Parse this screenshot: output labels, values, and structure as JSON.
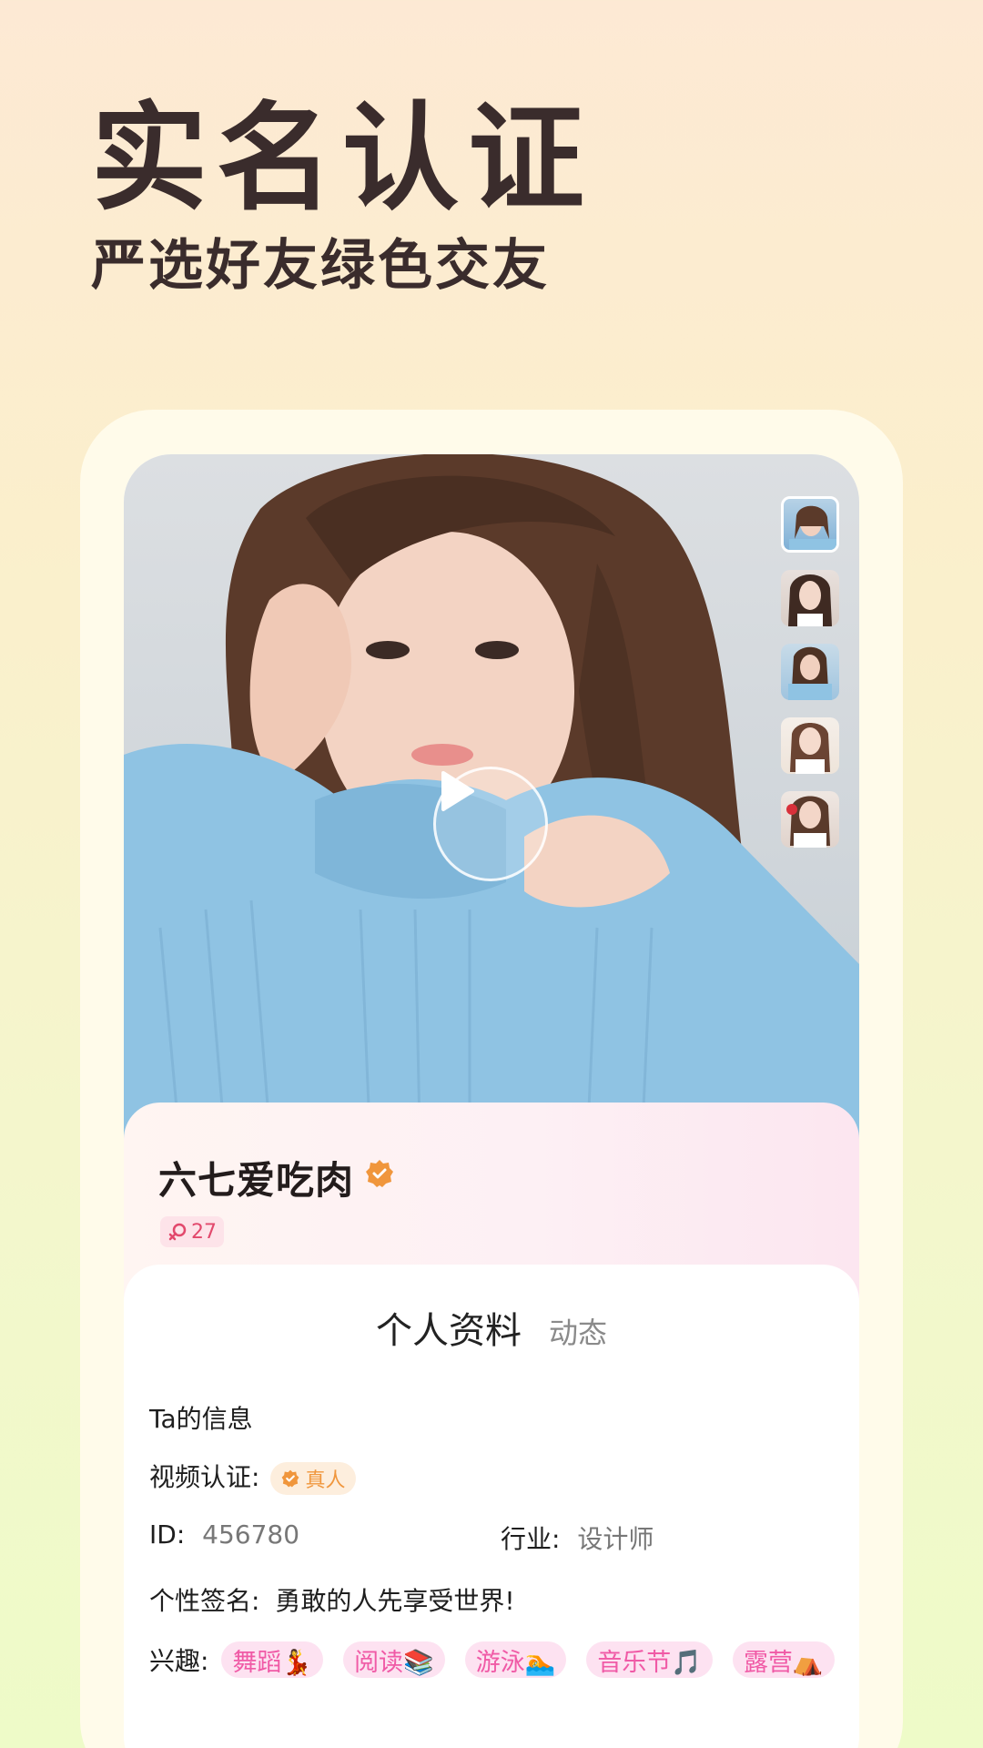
{
  "headline": {
    "title": "实名认证",
    "subtitle": "严选好友绿色交友"
  },
  "profile": {
    "name": "六七爱吃肉",
    "age": "27",
    "thumbnails_count": 5
  },
  "tabs": {
    "active": "个人资料",
    "inactive": "动态"
  },
  "info": {
    "section_title": "Ta的信息",
    "video_auth_label": "视频认证:",
    "video_auth_badge": "真人",
    "id_label": "ID:",
    "id_value": "456780",
    "industry_label": "行业:",
    "industry_value": "设计师",
    "signature_label": "个性签名:",
    "signature_value": "勇敢的人先享受世界!",
    "interests_label": "兴趣:",
    "interests": [
      "舞蹈💃",
      "阅读📚",
      "游泳🏊",
      "音乐节🎵",
      "露营⛺"
    ]
  },
  "colors": {
    "accent_orange": "#f0963c",
    "tag_pink": "#f05aa6",
    "age_pink": "#e2486c"
  }
}
